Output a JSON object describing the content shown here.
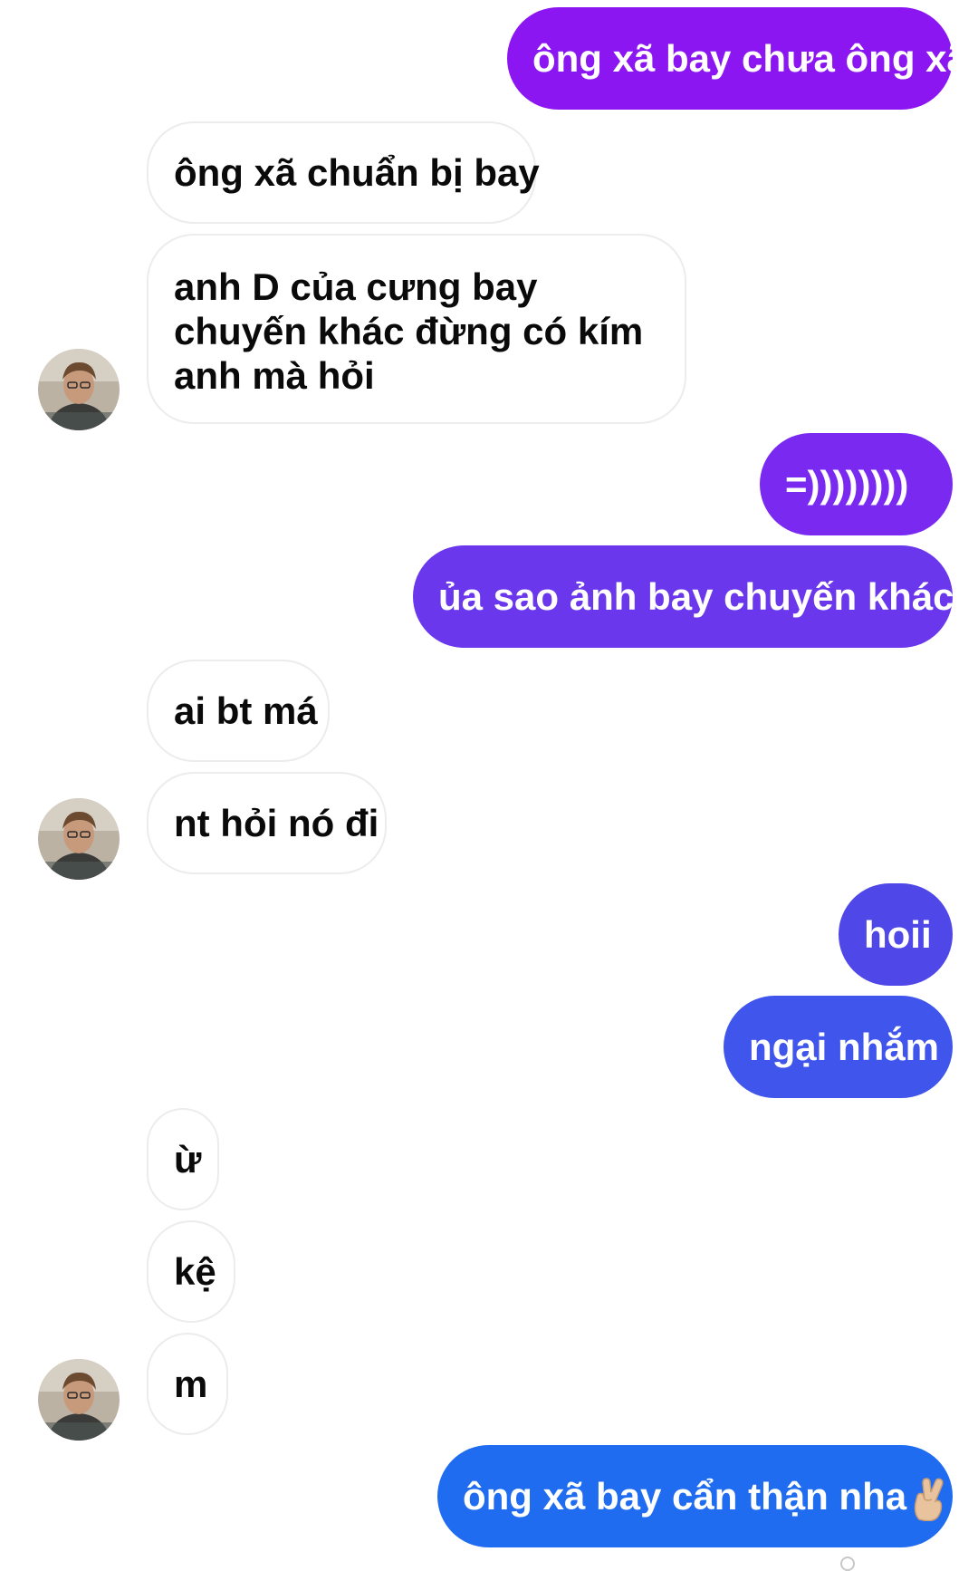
{
  "colors": {
    "outgoing_purple": "#8b17f0",
    "outgoing_violet": "#6a37ec",
    "outgoing_indigo": "#4f47e8",
    "outgoing_blue": "#1f6cf0",
    "incoming_bg": "#ffffff",
    "incoming_text": "#0a0a0a"
  },
  "messages": [
    {
      "id": "m1",
      "side": "out",
      "text": "ông xã bay chưa ông xã"
    },
    {
      "id": "m2",
      "side": "in",
      "text": "ông xã chuẩn bị bay"
    },
    {
      "id": "m3",
      "side": "in",
      "text": "anh D của cưng bay chuyến khác đừng có kím anh mà hỏi"
    },
    {
      "id": "m4",
      "side": "out",
      "text": "=))))))))"
    },
    {
      "id": "m5",
      "side": "out",
      "text": "ủa sao ảnh bay chuyến khác"
    },
    {
      "id": "m6",
      "side": "in",
      "text": "ai bt má"
    },
    {
      "id": "m7",
      "side": "in",
      "text": "nt hỏi nó đi"
    },
    {
      "id": "m8",
      "side": "out",
      "text": "hoii"
    },
    {
      "id": "m9",
      "side": "out",
      "text": "ngại nhắm"
    },
    {
      "id": "m10",
      "side": "in",
      "text": "ừ"
    },
    {
      "id": "m11",
      "side": "in",
      "text": "kệ"
    },
    {
      "id": "m12",
      "side": "in",
      "text": "m"
    },
    {
      "id": "m13",
      "side": "out",
      "text": "ông xã bay cẩn thận nha",
      "emoji": "crossed-fingers-icon"
    }
  ]
}
